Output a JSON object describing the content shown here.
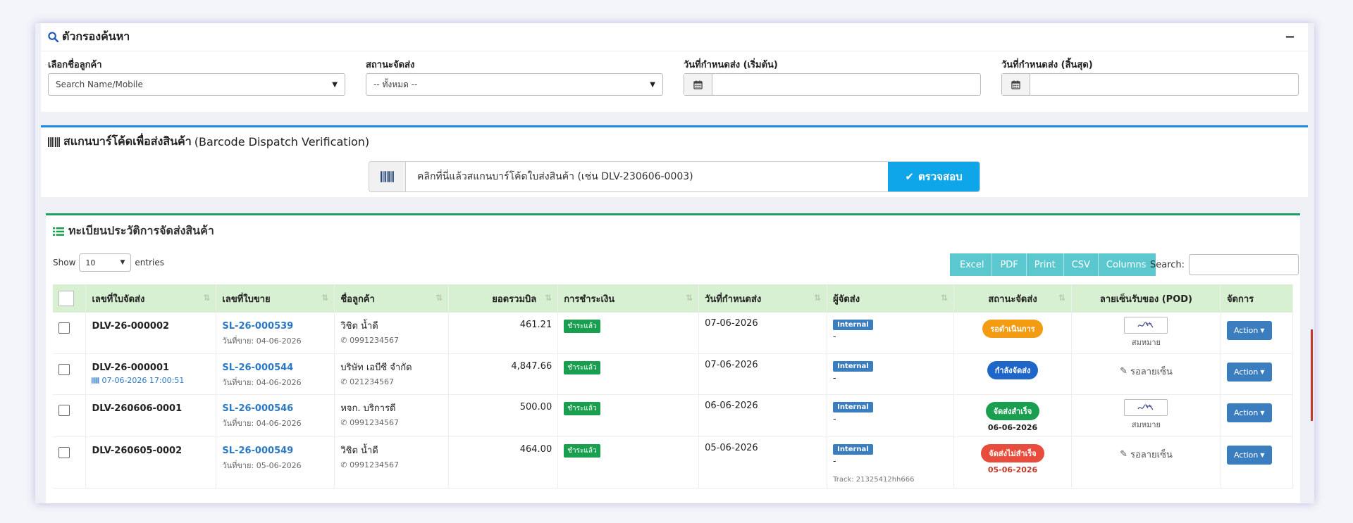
{
  "filter": {
    "title": "ตัวกรองค้นหา",
    "collapse": "−",
    "customer_label": "เลือกชื่อลูกค้า",
    "customer_placeholder": "Search Name/Mobile",
    "status_label": "สถานะจัดส่ง",
    "status_value": "-- ทั้งหมด --",
    "date_start_label": "วันที่กำหนดส่ง (เริ่มต้น)",
    "date_end_label": "วันที่กำหนดส่ง (สิ้นสุด)"
  },
  "barcode": {
    "title_th": "สแกนบาร์โค้ดเพื่อส่งสินค้า",
    "title_en": "(Barcode Dispatch Verification)",
    "placeholder": "คลิกที่นี่แล้วสแกนบาร์โค้ดใบส่งสินค้า (เช่น DLV-230606-0003)",
    "button": "ตรวจสอบ"
  },
  "history": {
    "title": "ทะเบียนประวัติการจัดส่งสินค้า",
    "show_label": "Show",
    "entries_value": "10",
    "entries_label": "entries",
    "search_label": "Search:",
    "exports": [
      "Excel",
      "PDF",
      "Print",
      "CSV",
      "Columns"
    ],
    "columns": [
      "เลขที่ใบจัดส่ง",
      "เลขที่ใบขาย",
      "ชื่อลูกค้า",
      "ยอดรวมบิล",
      "การชำระเงิน",
      "วันที่กำหนดส่ง",
      "ผู้จัดส่ง",
      "สถานะจัดส่ง",
      "ลายเซ็นรับของ (POD)",
      "จัดการ"
    ],
    "rows": [
      {
        "dlv": "DLV-26-000002",
        "dlv_stamp": "",
        "sl": "SL-26-000539",
        "sale_date": "วันที่ขาย: 04-06-2026",
        "customer": "วิชิต น้ำดี",
        "phone": "0991234567",
        "total": "461.21",
        "payment": "ชำระแล้ว",
        "due": "07-06-2026",
        "courier": "Internal",
        "courier_sub": "-",
        "track": "",
        "status": "รอดำเนินการ",
        "status_date": "",
        "pod_label": "สมหมาย",
        "action": "Action"
      },
      {
        "dlv": "DLV-26-000001",
        "dlv_stamp": "07-06-2026 17:00:51",
        "sl": "SL-26-000544",
        "sale_date": "วันที่ขาย: 04-06-2026",
        "customer": "บริษัท เอบีซี จำกัด",
        "phone": "021234567",
        "total": "4,847.66",
        "payment": "ชำระแล้ว",
        "due": "07-06-2026",
        "courier": "Internal",
        "courier_sub": "-",
        "track": "",
        "status": "กำลังจัดส่ง",
        "status_date": "",
        "pod_label": "รอลายเซ็น",
        "action": "Action"
      },
      {
        "dlv": "DLV-260606-0001",
        "dlv_stamp": "",
        "sl": "SL-26-000546",
        "sale_date": "วันที่ขาย: 04-06-2026",
        "customer": "หจก. บริการดี",
        "phone": "0991234567",
        "total": "500.00",
        "payment": "ชำระแล้ว",
        "due": "06-06-2026",
        "courier": "Internal",
        "courier_sub": "-",
        "track": "",
        "status": "จัดส่งสำเร็จ",
        "status_date": "06-06-2026",
        "pod_label": "สมหมาย",
        "action": "Action"
      },
      {
        "dlv": "DLV-260605-0002",
        "dlv_stamp": "",
        "sl": "SL-26-000549",
        "sale_date": "วันที่ขาย: 05-06-2026",
        "customer": "วิชิต น้ำดี",
        "phone": "0991234567",
        "total": "464.00",
        "payment": "ชำระแล้ว",
        "due": "05-06-2026",
        "courier": "Internal",
        "courier_sub": "-",
        "track": "Track: 21325412hh666",
        "status": "จัดส่งไม่สำเร็จ",
        "status_date": "05-06-2026",
        "pod_label": "รอลายเซ็น",
        "action": "Action"
      }
    ]
  },
  "colors": {
    "accent_blue": "#1e88e5",
    "accent_green": "#1aa260",
    "scan_button": "#0ea5e9",
    "export_button": "#5bc8d0",
    "header_bg": "#d8f0d2",
    "processing": "#f39c12",
    "shipping": "#1e66c8",
    "success": "#1a9e50",
    "failed": "#e74c3c"
  }
}
